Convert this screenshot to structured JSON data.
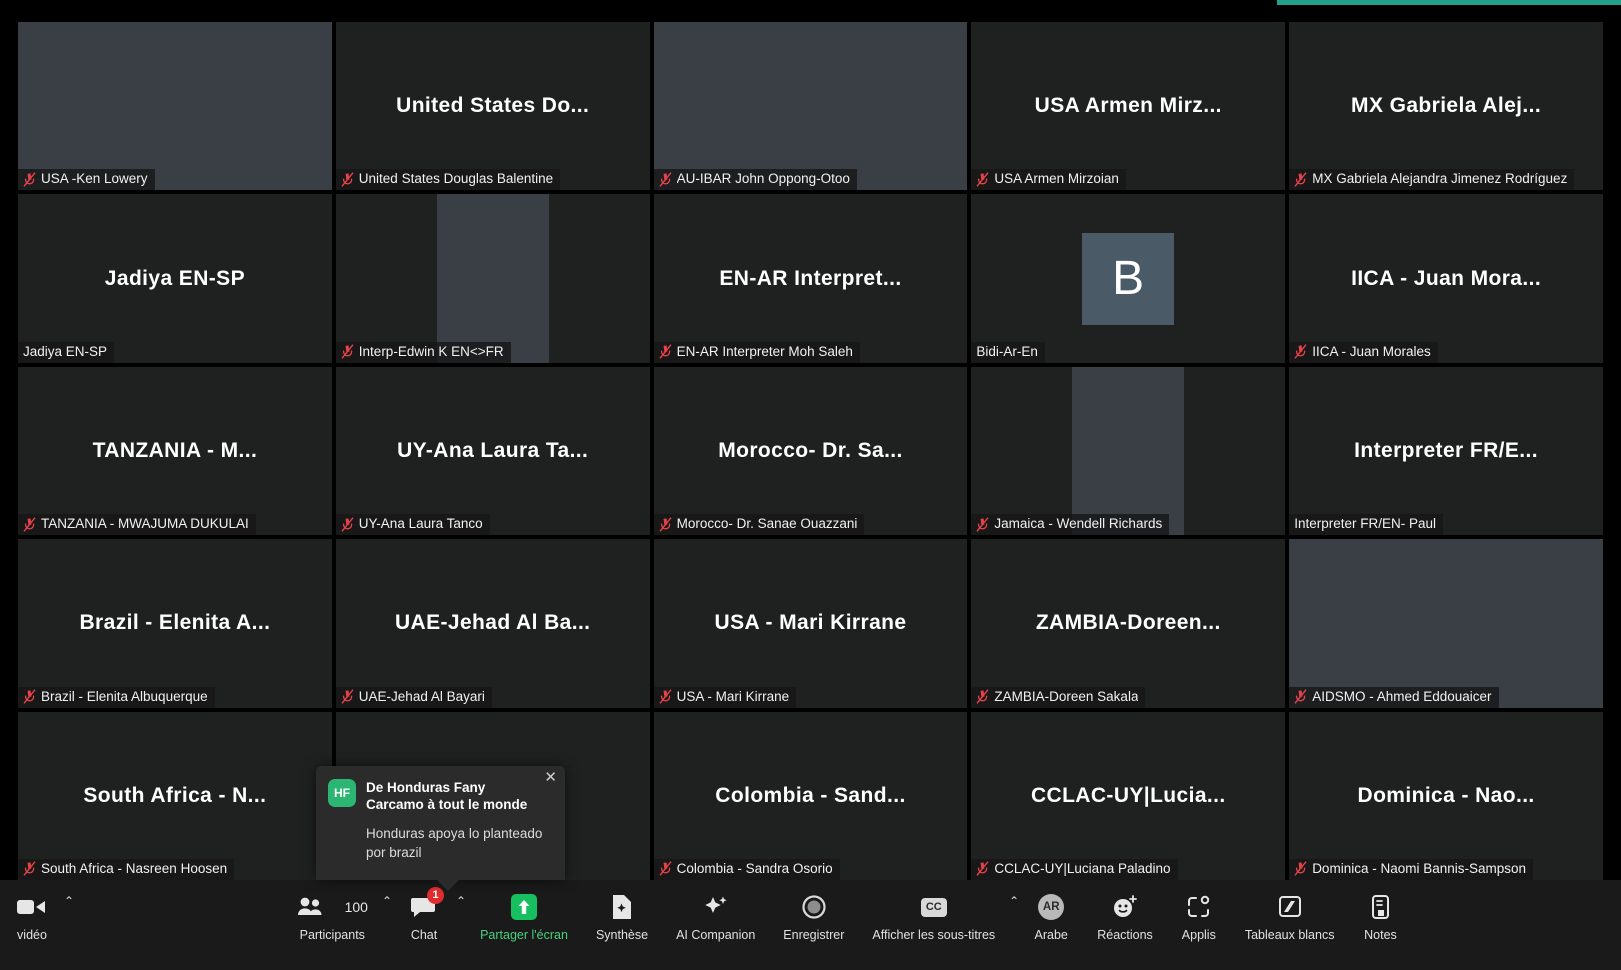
{
  "meeting": {
    "layout": "gallery-view",
    "accent_color": "#26a189",
    "tile_background": "#1f2020",
    "avatar_color": "#4a5a66",
    "muted_icon_color": "#e8434a"
  },
  "participants": [
    {
      "display": "USA -Ken Lowery",
      "big": "",
      "muted": true,
      "video": true,
      "photo": "wide"
    },
    {
      "display": "United States Douglas Balentine",
      "big": "United States Do...",
      "muted": true,
      "video": false,
      "photo": ""
    },
    {
      "display": "AU-IBAR John Oppong-Otoo",
      "big": "",
      "muted": true,
      "video": true,
      "photo": "wide"
    },
    {
      "display": "USA Armen Mirzoian",
      "big": "USA Armen Mirz...",
      "muted": true,
      "video": false,
      "photo": ""
    },
    {
      "display": "MX Gabriela Alejandra Jimenez Rodríguez",
      "big": "MX Gabriela Alej...",
      "muted": true,
      "video": false,
      "photo": ""
    },
    {
      "display": "Jadiya EN-SP",
      "big": "Jadiya EN-SP",
      "muted": false,
      "video": false,
      "photo": ""
    },
    {
      "display": "Interp-Edwin K EN<>FR",
      "big": "",
      "muted": true,
      "video": true,
      "photo": "mid"
    },
    {
      "display": "EN-AR Interpreter Moh Saleh",
      "big": "EN-AR Interpret...",
      "muted": true,
      "video": false,
      "photo": ""
    },
    {
      "display": "Bidi-Ar-En",
      "big": "",
      "muted": false,
      "video": false,
      "photo": "",
      "initial": "B"
    },
    {
      "display": "IICA - Juan Morales",
      "big": "IICA - Juan Mora...",
      "muted": true,
      "video": false,
      "photo": ""
    },
    {
      "display": "TANZANIA - MWAJUMA DUKULAI",
      "big": "TANZANIA - M...",
      "muted": true,
      "video": false,
      "photo": ""
    },
    {
      "display": "UY-Ana Laura Tanco",
      "big": "UY-Ana Laura Ta...",
      "muted": true,
      "video": false,
      "photo": ""
    },
    {
      "display": "Morocco- Dr. Sanae Ouazzani",
      "big": "Morocco- Dr. Sa...",
      "muted": true,
      "video": false,
      "photo": ""
    },
    {
      "display": "Jamaica - Wendell Richards",
      "big": "",
      "muted": true,
      "video": true,
      "photo": "mid"
    },
    {
      "display": "Interpreter FR/EN- Paul",
      "big": "Interpreter FR/E...",
      "muted": false,
      "video": false,
      "photo": ""
    },
    {
      "display": "Brazil - Elenita Albuquerque",
      "big": "Brazil - Elenita A...",
      "muted": true,
      "video": false,
      "photo": ""
    },
    {
      "display": "UAE-Jehad Al Bayari",
      "big": "UAE-Jehad Al Ba...",
      "muted": true,
      "video": false,
      "photo": ""
    },
    {
      "display": "USA - Mari Kirrane",
      "big": "USA - Mari Kirrane",
      "muted": true,
      "video": false,
      "photo": ""
    },
    {
      "display": "ZAMBIA-Doreen Sakala",
      "big": "ZAMBIA-Doreen...",
      "muted": true,
      "video": false,
      "photo": ""
    },
    {
      "display": "AIDSMO - Ahmed Eddouaicer",
      "big": "",
      "muted": true,
      "video": true,
      "photo": "wide"
    },
    {
      "display": "South Africa - Nasreen Hoosen",
      "big": "South Africa - N...",
      "muted": true,
      "video": false,
      "photo": ""
    },
    {
      "display": "",
      "big": "",
      "muted": false,
      "video": false,
      "photo": ""
    },
    {
      "display": "Colombia - Sandra Osorio",
      "big": "Colombia - Sand...",
      "muted": true,
      "video": false,
      "photo": ""
    },
    {
      "display": "CCLAC-UY|Luciana Paladino",
      "big": "CCLAC-UY|Lucia...",
      "muted": true,
      "video": false,
      "photo": ""
    },
    {
      "display": "Dominica - Naomi Bannis-Sampson",
      "big": "Dominica - Nao...",
      "muted": true,
      "video": false,
      "photo": ""
    }
  ],
  "chat_toast": {
    "avatar_initials": "HF",
    "header": "De Honduras Fany Carcamo à tout le monde",
    "message": "Honduras apoya lo planteado por brazil",
    "close_label": "✕"
  },
  "toolbar": {
    "video": {
      "label": "vidéo",
      "icon": "camera-icon"
    },
    "participants": {
      "label": "Participants",
      "count": "100",
      "icon": "people-icon"
    },
    "chat": {
      "label": "Chat",
      "badge": "1",
      "icon": "chat-bubble-icon"
    },
    "share": {
      "label": "Partager l'écran",
      "icon": "share-screen-icon",
      "color": "#4ad07d"
    },
    "summary": {
      "label": "Synthèse",
      "icon": "document-sparkle-icon"
    },
    "companion": {
      "label": "AI Companion",
      "icon": "sparkle-icon"
    },
    "record": {
      "label": "Enregistrer",
      "icon": "record-circle-icon"
    },
    "captions": {
      "label": "Afficher les sous-titres",
      "icon": "cc-icon",
      "cc_text": "CC"
    },
    "language": {
      "label": "Arabe",
      "icon": "interpretation-icon",
      "badge_text": "AR"
    },
    "reactions": {
      "label": "Réactions",
      "icon": "smiley-plus-icon"
    },
    "apps": {
      "label": "Applis",
      "icon": "apps-icon"
    },
    "whiteboards": {
      "label": "Tableaux blancs",
      "icon": "whiteboard-icon"
    },
    "notes": {
      "label": "Notes",
      "icon": "notes-icon"
    },
    "caret": "⌃"
  }
}
